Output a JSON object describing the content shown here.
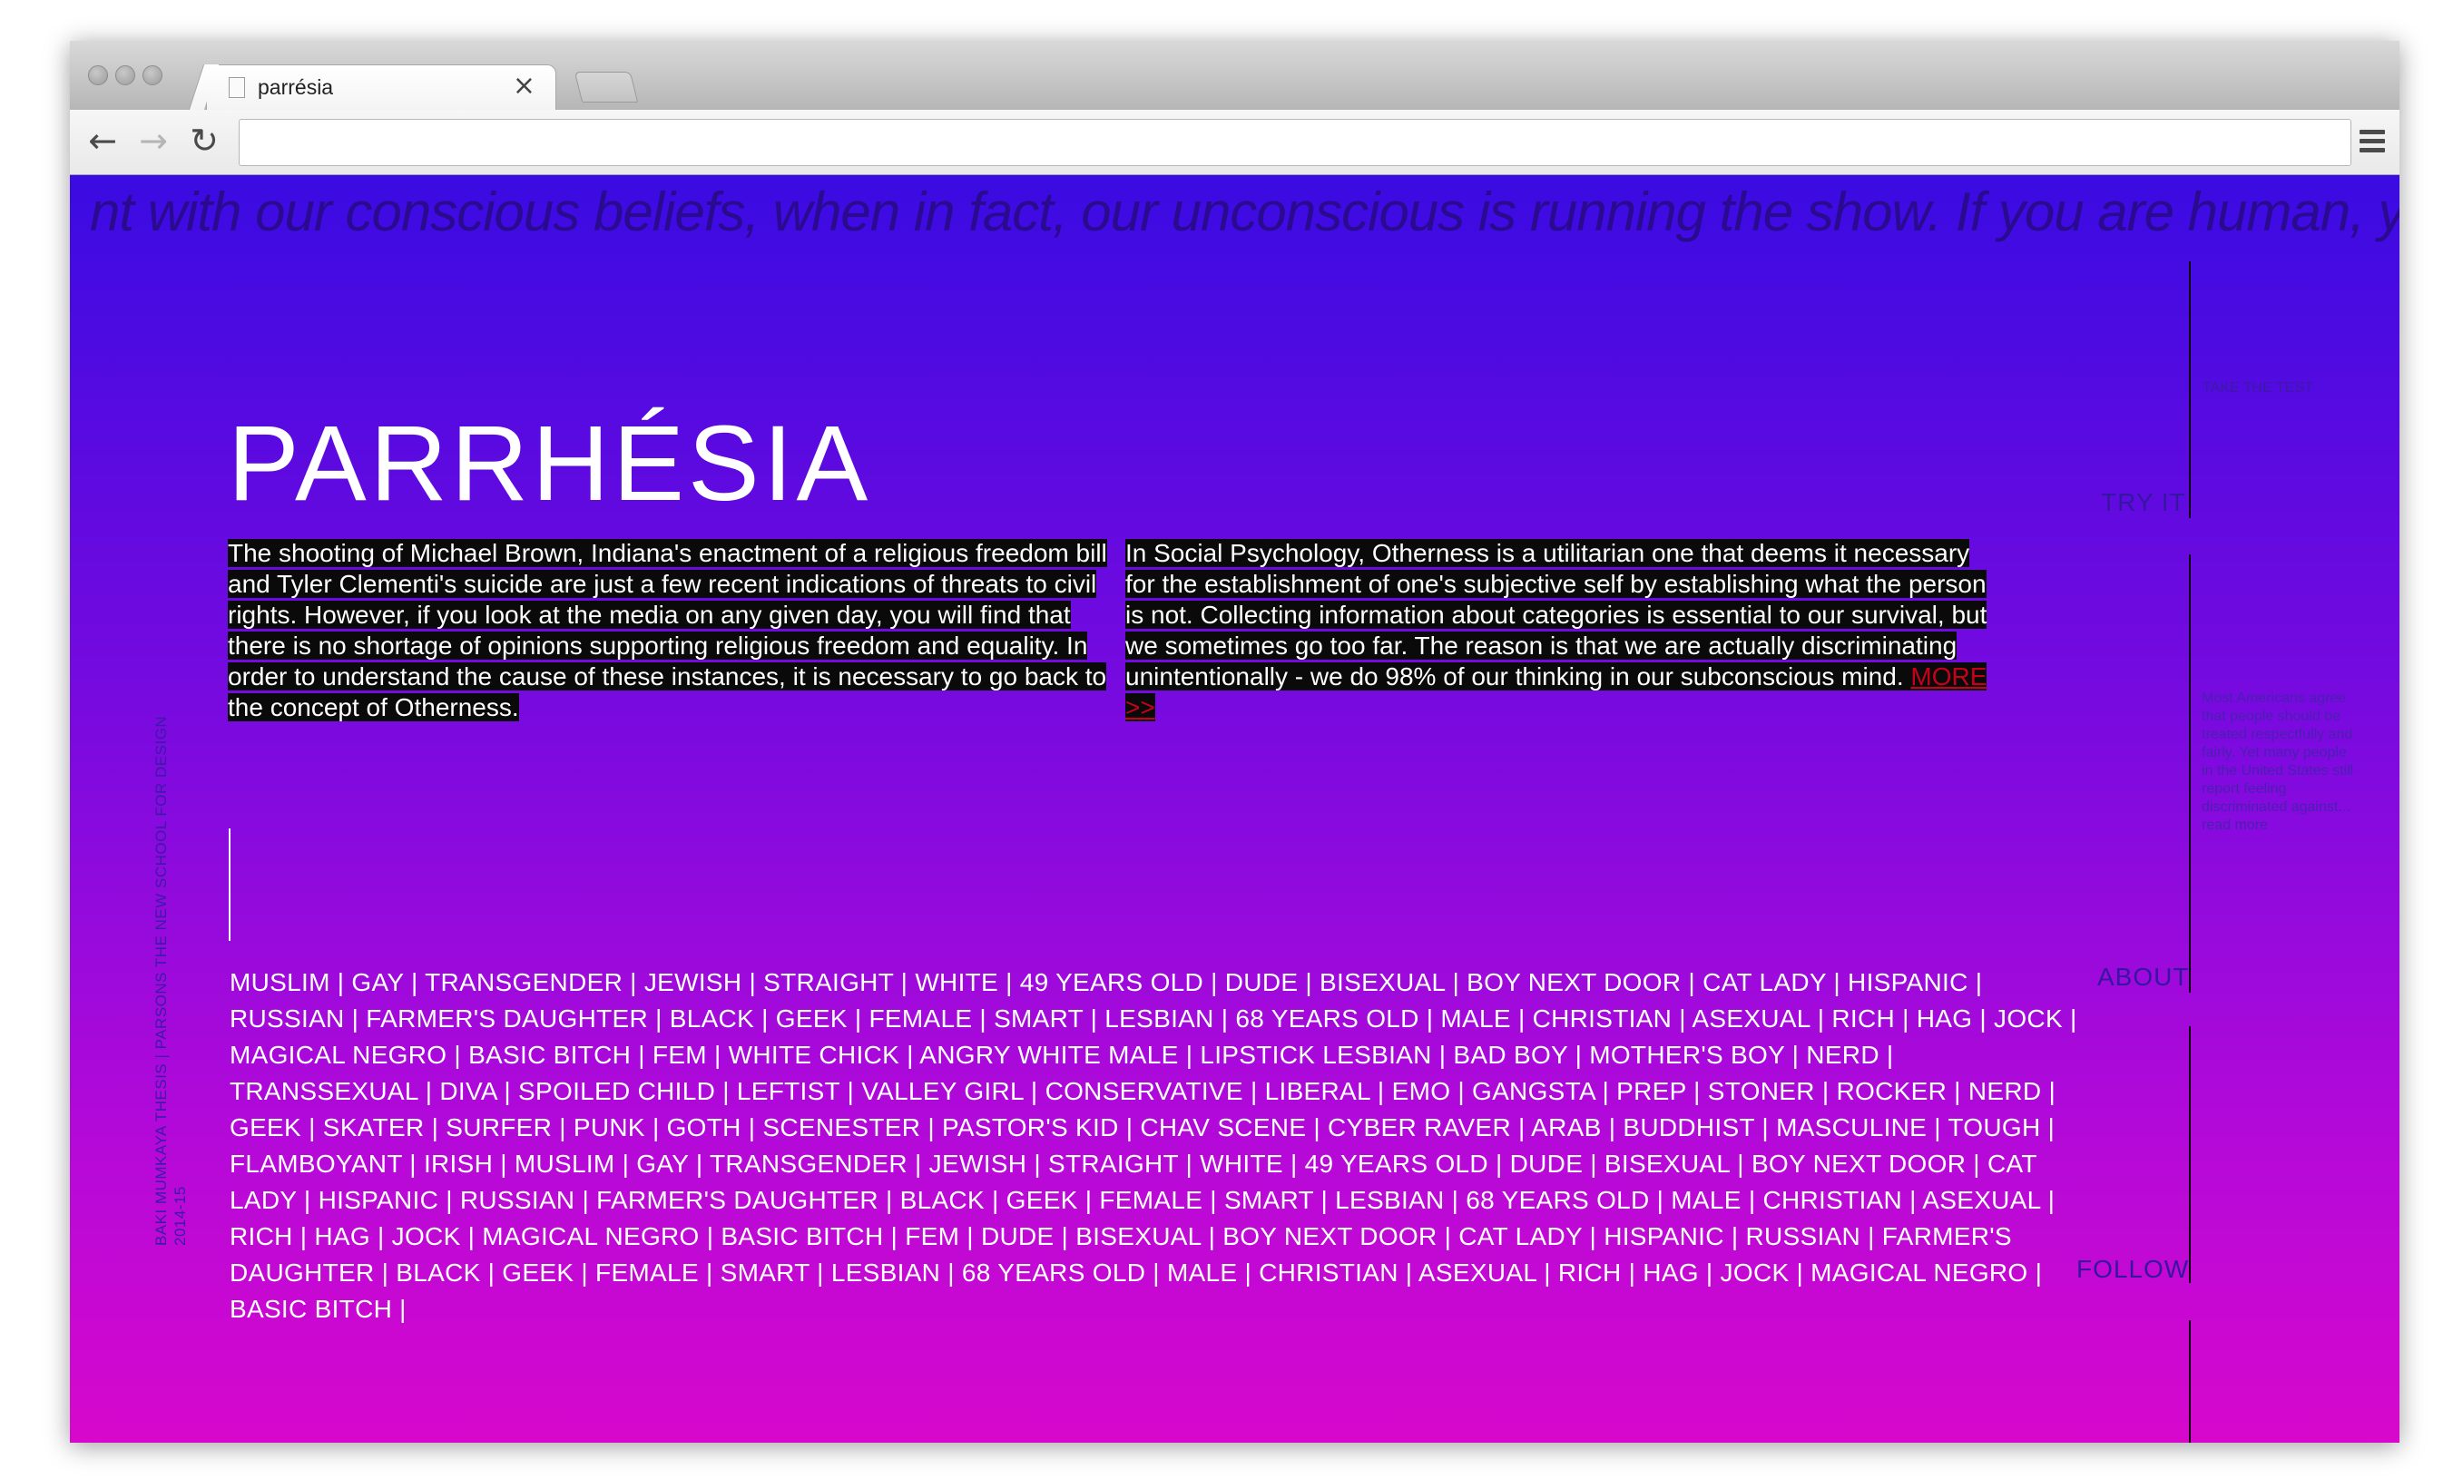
{
  "browser": {
    "tab_title": "parrésia",
    "tab_close": "×",
    "back": "←",
    "forward": "→",
    "reload": "↻",
    "url": ""
  },
  "page": {
    "ticker": "nt with our conscious beliefs, when in fact, our unconscious is running the show. If you are human, y",
    "credit_line1": "BAKI MUMKAYA THESIS | PARSONS THE NEW SCHOOL FOR DESIGN",
    "credit_line2": "2014-15",
    "logo": "PARRHÉSIA",
    "intro_left": "The shooting of Michael Brown, Indiana's enactment of a religious freedom bill and Tyler Clementi's suicide are just a few recent indications of threats to civil rights. However, if you look at the media on any given day, you will find that there is no shortage of opinions supporting religious freedom and equality. In order to understand the cause of these instances, it is necessary to go back to the concept of Otherness. ",
    "intro_right": "In Social Psychology, Otherness is a utilitarian one that deems it necessary for the establishment of one's subjective self by establishing what the person is not. Collecting information about categories is essential to our survival, but we sometimes go too far. The reason is that we are actually discriminating unintentionally - we do 98% of our thinking in our subconscious mind. ",
    "more_link": "MORE >>",
    "tags": "MUSLIM | GAY | TRANSGENDER | JEWISH | STRAIGHT | WHITE | 49 YEARS OLD | DUDE | BISEXUAL | BOY NEXT DOOR | CAT LADY | HISPANIC | RUSSIAN | FARMER'S DAUGHTER | BLACK | GEEK | FEMALE | SMART | LESBIAN | 68 YEARS OLD | MALE | CHRISTIAN | ASEXUAL | RICH | HAG | JOCK | MAGICAL NEGRO | BASIC BITCH | FEM | WHITE CHICK | ANGRY WHITE MALE | LIPSTICK LESBIAN | BAD BOY | MOTHER'S BOY | NERD | TRANSSEXUAL | DIVA | SPOILED CHILD | LEFTIST | VALLEY GIRL | CONSERVATIVE | LIBERAL | EMO | GANGSTA | PREP | STONER | ROCKER | NERD | GEEK | SKATER | SURFER | PUNK | GOTH | SCENESTER | PASTOR'S KID | CHAV SCENE | CYBER RAVER | ARAB | BUDDHIST | MASCULINE | TOUGH | FLAMBOYANT | IRISH | MUSLIM | GAY | TRANSGENDER | JEWISH | STRAIGHT | WHITE | 49 YEARS OLD | DUDE | BISEXUAL | BOY NEXT DOOR | CAT LADY | HISPANIC | RUSSIAN | FARMER'S DAUGHTER | BLACK | GEEK | FEMALE | SMART | LESBIAN | 68 YEARS OLD | MALE | CHRISTIAN | ASEXUAL | RICH | HAG | JOCK | MAGICAL NEGRO | BASIC BITCH | FEM | DUDE | BISEXUAL | BOY NEXT DOOR | CAT LADY | HISPANIC | RUSSIAN | FARMER'S DAUGHTER | BLACK | GEEK | FEMALE | SMART | LESBIAN | 68 YEARS OLD | MALE | CHRISTIAN | ASEXUAL | RICH | HAG | JOCK | MAGICAL NEGRO | BASIC BITCH |"
  },
  "sidebar": {
    "take_test": "TAKE THE TEST",
    "try_it": "TRY IT",
    "note": "Most Americans agree that people should be treated respectfully and fairly. Yet many people in the United States still report feeling discriminated against... read more",
    "about": "ABOUT",
    "follow": "FOLLOW"
  },
  "colors": {
    "gradient_top": "#3a0be2",
    "gradient_bottom": "#d708cc",
    "highlight": "#0a0a0a",
    "more_link": "#c8001a"
  }
}
